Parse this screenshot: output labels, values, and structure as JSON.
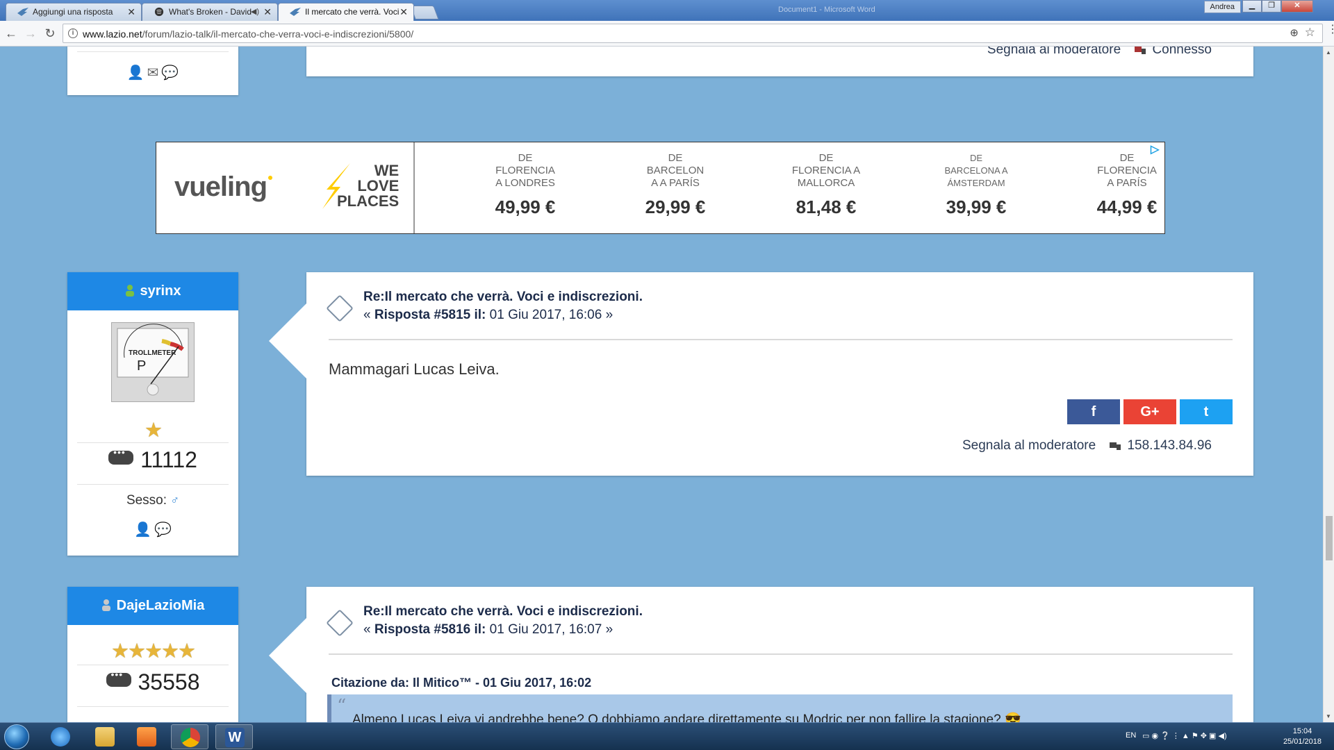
{
  "browser": {
    "tabs": [
      {
        "title": "Aggiungi una risposta"
      },
      {
        "title": "What's Broken - David"
      },
      {
        "title": "Il mercato che verrà. Voci"
      }
    ],
    "window_title": "Document1 - Microsoft Word",
    "user": "Andrea",
    "url_host": "www.lazio.net",
    "url_path": "/forum/lazio-talk/il-mercato-che-verra-voci-e-indiscrezioni/5800/"
  },
  "prev_post": {
    "report_label": "Segnala al moderatore",
    "ip_label": "Connesso"
  },
  "ad": {
    "brand": "vueling",
    "slogan": [
      "WE",
      "LOVE",
      "PLACES"
    ],
    "routes": [
      {
        "lines": [
          "DE",
          "FLORENCIA",
          "A LONDRES"
        ],
        "price": "49,99 €"
      },
      {
        "lines": [
          "DE",
          "BARCELON",
          "A A PARÍS"
        ],
        "price": "29,99 €"
      },
      {
        "lines": [
          "DE",
          "FLORENCIA A",
          "MALLORCA"
        ],
        "price": "81,48 €"
      },
      {
        "lines": [
          "DE",
          "BARCELONA A",
          "ÁMSTERDAM"
        ],
        "price": "39,99 €"
      },
      {
        "lines": [
          "DE",
          "FLORENCIA",
          "A PARÍS"
        ],
        "price": "44,99 €"
      }
    ]
  },
  "posts": [
    {
      "author": "syrinx",
      "avatar_text": "TROLLMETER",
      "stars": "★",
      "post_count": "11112",
      "sex_label": "Sesso:",
      "sex_icon": "♂",
      "title": "Re:Il mercato che verrà. Voci e indiscrezioni.",
      "meta_prefix": "«",
      "meta_bold": "Risposta #5815 il:",
      "meta_date": "01 Giu 2017, 16:06 »",
      "body": "Mammagari Lucas Leiva.",
      "report_label": "Segnala al moderatore",
      "ip": "158.143.84.96"
    },
    {
      "author": "DajeLazioMia",
      "stars": "★★★★★",
      "post_count": "35558",
      "title": "Re:Il mercato che verrà. Voci e indiscrezioni.",
      "meta_prefix": "«",
      "meta_bold": "Risposta #5816 il:",
      "meta_date": "01 Giu 2017, 16:07 »",
      "quote_head": "Citazione da: Il Mitico™ - 01 Giu 2017, 16:02",
      "quote_text": "Almeno Lucas Leiva vi andrebbe bene? O dobbiamo andare direttamente su Modric per non fallire la stagione? 😎"
    }
  ],
  "social": {
    "facebook": "f",
    "google": "G+",
    "twitter": "t"
  },
  "colors": {
    "page_bg": "#7cb0d8",
    "header_blue": "#1e88e5",
    "fb": "#3b5998",
    "gplus": "#ea4335",
    "tw": "#1da1f2"
  },
  "taskbar": {
    "lang": "EN",
    "time": "15:04",
    "date": "25/01/2018"
  }
}
